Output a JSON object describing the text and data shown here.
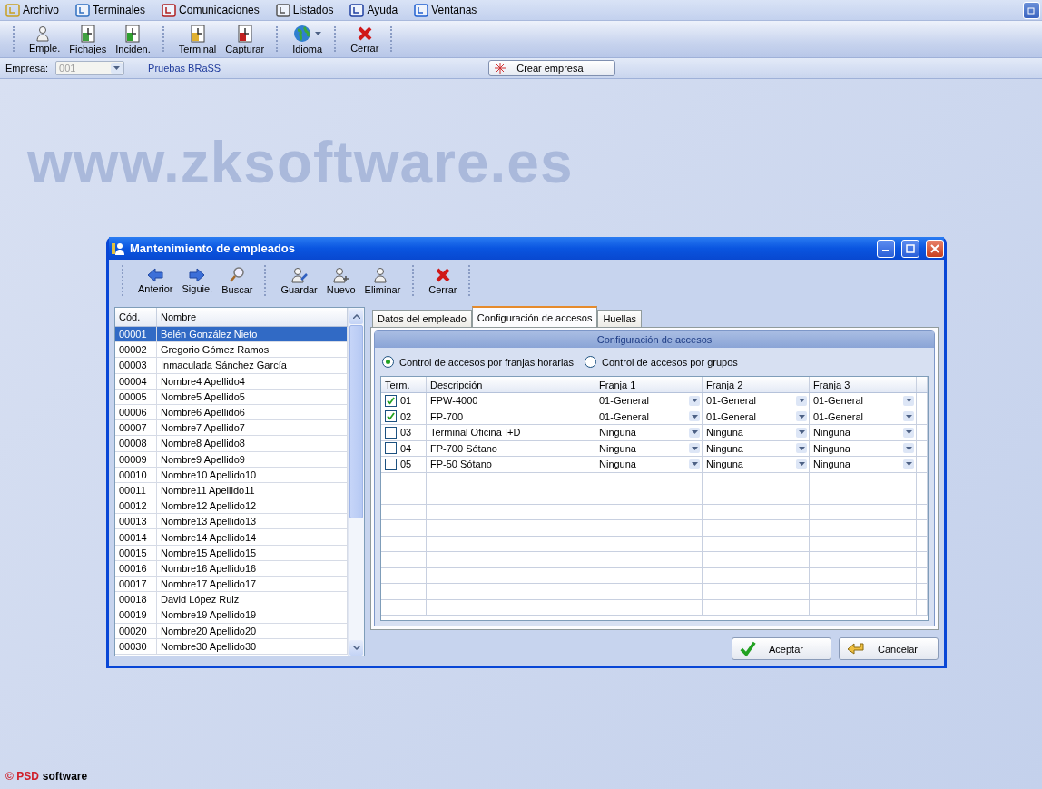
{
  "menu_bar": {
    "items": [
      {
        "label": "Archivo"
      },
      {
        "label": "Terminales"
      },
      {
        "label": "Comunicaciones"
      },
      {
        "label": "Listados"
      },
      {
        "label": "Ayuda"
      },
      {
        "label": "Ventanas"
      }
    ]
  },
  "toolbar": {
    "groups": [
      [
        {
          "label": "Emple."
        },
        {
          "label": "Fichajes"
        },
        {
          "label": "Inciden."
        }
      ],
      [
        {
          "label": "Terminal"
        },
        {
          "label": "Capturar"
        }
      ],
      [
        {
          "label": "Idioma",
          "dropdown": true
        }
      ],
      [
        {
          "label": "Cerrar"
        }
      ]
    ]
  },
  "company_bar": {
    "label": "Empresa:",
    "value": "001",
    "disabled": true,
    "company_name": "Pruebas BRaSS",
    "button": "Crear empresa"
  },
  "background": {
    "logo_text": "www.zksoftware.es"
  },
  "child_window": {
    "title": "Mantenimiento de empleados",
    "toolbar": [
      [
        {
          "label": "Anterior"
        },
        {
          "label": "Siguie."
        },
        {
          "label": "Buscar"
        }
      ],
      [
        {
          "label": "Guardar"
        },
        {
          "label": "Nuevo"
        },
        {
          "label": "Eliminar"
        }
      ],
      [
        {
          "label": "Cerrar"
        }
      ]
    ],
    "employee_list": {
      "columns": [
        "Cód.",
        "Nombre"
      ],
      "rows": [
        {
          "code": "00001",
          "name": "Belén González Nieto",
          "selected": true
        },
        {
          "code": "00002",
          "name": "Gregorio Gómez Ramos",
          "selected": false
        },
        {
          "code": "00003",
          "name": "Inmaculada Sánchez García",
          "selected": false
        },
        {
          "code": "00004",
          "name": "Nombre4 Apellido4",
          "selected": false
        },
        {
          "code": "00005",
          "name": "Nombre5 Apellido5",
          "selected": false
        },
        {
          "code": "00006",
          "name": "Nombre6 Apellido6",
          "selected": false
        },
        {
          "code": "00007",
          "name": "Nombre7 Apellido7",
          "selected": false
        },
        {
          "code": "00008",
          "name": "Nombre8 Apellido8",
          "selected": false
        },
        {
          "code": "00009",
          "name": "Nombre9 Apellido9",
          "selected": false
        },
        {
          "code": "00010",
          "name": "Nombre10 Apellido10",
          "selected": false
        },
        {
          "code": "00011",
          "name": "Nombre11 Apellido11",
          "selected": false
        },
        {
          "code": "00012",
          "name": "Nombre12 Apellido12",
          "selected": false
        },
        {
          "code": "00013",
          "name": "Nombre13 Apellido13",
          "selected": false
        },
        {
          "code": "00014",
          "name": "Nombre14 Apellido14",
          "selected": false
        },
        {
          "code": "00015",
          "name": "Nombre15 Apellido15",
          "selected": false
        },
        {
          "code": "00016",
          "name": "Nombre16 Apellido16",
          "selected": false
        },
        {
          "code": "00017",
          "name": "Nombre17 Apellido17",
          "selected": false
        },
        {
          "code": "00018",
          "name": "David López Ruiz",
          "selected": false
        },
        {
          "code": "00019",
          "name": "Nombre19 Apellido19",
          "selected": false
        },
        {
          "code": "00020",
          "name": "Nombre20 Apellido20",
          "selected": false
        },
        {
          "code": "00030",
          "name": "Nombre30 Apellido30",
          "selected": false
        }
      ]
    },
    "tabs": [
      {
        "label": "Datos del empleado",
        "selected": false
      },
      {
        "label": "Configuración de accesos",
        "selected": true
      },
      {
        "label": "Huellas",
        "selected": false
      }
    ],
    "access_panel": {
      "title": "Configuración de accesos",
      "radios": [
        {
          "label": "Control de accesos por franjas horarias",
          "selected": true
        },
        {
          "label": "Control de accesos por grupos",
          "selected": false
        }
      ],
      "grid": {
        "columns": [
          "Term.",
          "Descripción",
          "Franja 1",
          "Franja 2",
          "Franja 3"
        ],
        "rows": [
          {
            "checked": true,
            "term": "01",
            "description": "FPW-4000",
            "franja_1": "01-General",
            "franja_2": "01-General",
            "franja_3": "01-General"
          },
          {
            "checked": true,
            "term": "02",
            "description": "FP-700",
            "franja_1": "01-General",
            "franja_2": "01-General",
            "franja_3": "01-General"
          },
          {
            "checked": false,
            "term": "03",
            "description": "Terminal Oficina I+D",
            "franja_1": "Ninguna",
            "franja_2": "Ninguna",
            "franja_3": "Ninguna"
          },
          {
            "checked": false,
            "term": "04",
            "description": "FP-700 Sótano",
            "franja_1": "Ninguna",
            "franja_2": "Ninguna",
            "franja_3": "Ninguna"
          },
          {
            "checked": false,
            "term": "05",
            "description": "FP-50 Sótano",
            "franja_1": "Ninguna",
            "franja_2": "Ninguna",
            "franja_3": "Ninguna"
          }
        ]
      }
    },
    "buttons": [
      {
        "label": "Aceptar"
      },
      {
        "label": "Cancelar"
      }
    ]
  },
  "footer": {
    "brand": "© PSD",
    "text": "software"
  }
}
